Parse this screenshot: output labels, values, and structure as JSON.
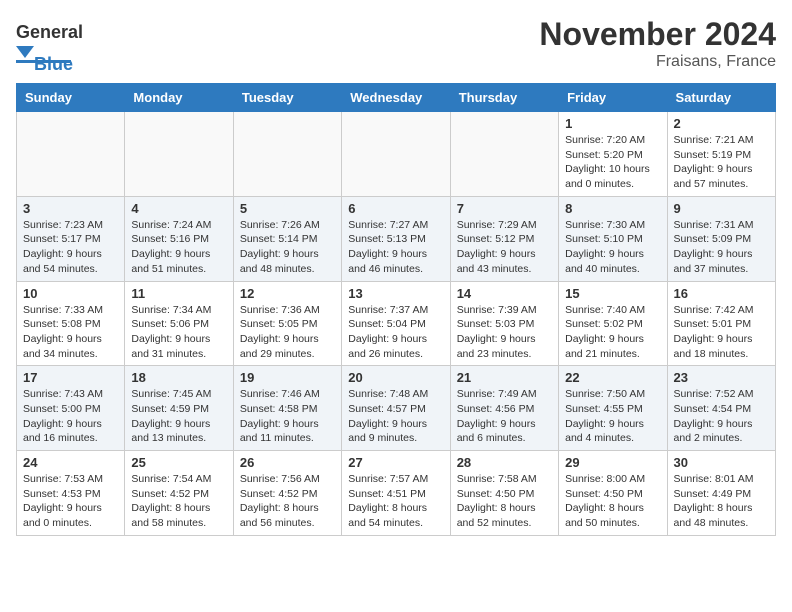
{
  "header": {
    "logo_general": "General",
    "logo_blue": "Blue",
    "title": "November 2024",
    "subtitle": "Fraisans, France"
  },
  "weekdays": [
    "Sunday",
    "Monday",
    "Tuesday",
    "Wednesday",
    "Thursday",
    "Friday",
    "Saturday"
  ],
  "weeks": [
    [
      {
        "day": "",
        "empty": true
      },
      {
        "day": "",
        "empty": true
      },
      {
        "day": "",
        "empty": true
      },
      {
        "day": "",
        "empty": true
      },
      {
        "day": "",
        "empty": true
      },
      {
        "day": "1",
        "sunrise": "7:20 AM",
        "sunset": "5:20 PM",
        "daylight": "10 hours and 0 minutes."
      },
      {
        "day": "2",
        "sunrise": "7:21 AM",
        "sunset": "5:19 PM",
        "daylight": "9 hours and 57 minutes."
      }
    ],
    [
      {
        "day": "3",
        "sunrise": "7:23 AM",
        "sunset": "5:17 PM",
        "daylight": "9 hours and 54 minutes."
      },
      {
        "day": "4",
        "sunrise": "7:24 AM",
        "sunset": "5:16 PM",
        "daylight": "9 hours and 51 minutes."
      },
      {
        "day": "5",
        "sunrise": "7:26 AM",
        "sunset": "5:14 PM",
        "daylight": "9 hours and 48 minutes."
      },
      {
        "day": "6",
        "sunrise": "7:27 AM",
        "sunset": "5:13 PM",
        "daylight": "9 hours and 46 minutes."
      },
      {
        "day": "7",
        "sunrise": "7:29 AM",
        "sunset": "5:12 PM",
        "daylight": "9 hours and 43 minutes."
      },
      {
        "day": "8",
        "sunrise": "7:30 AM",
        "sunset": "5:10 PM",
        "daylight": "9 hours and 40 minutes."
      },
      {
        "day": "9",
        "sunrise": "7:31 AM",
        "sunset": "5:09 PM",
        "daylight": "9 hours and 37 minutes."
      }
    ],
    [
      {
        "day": "10",
        "sunrise": "7:33 AM",
        "sunset": "5:08 PM",
        "daylight": "9 hours and 34 minutes."
      },
      {
        "day": "11",
        "sunrise": "7:34 AM",
        "sunset": "5:06 PM",
        "daylight": "9 hours and 31 minutes."
      },
      {
        "day": "12",
        "sunrise": "7:36 AM",
        "sunset": "5:05 PM",
        "daylight": "9 hours and 29 minutes."
      },
      {
        "day": "13",
        "sunrise": "7:37 AM",
        "sunset": "5:04 PM",
        "daylight": "9 hours and 26 minutes."
      },
      {
        "day": "14",
        "sunrise": "7:39 AM",
        "sunset": "5:03 PM",
        "daylight": "9 hours and 23 minutes."
      },
      {
        "day": "15",
        "sunrise": "7:40 AM",
        "sunset": "5:02 PM",
        "daylight": "9 hours and 21 minutes."
      },
      {
        "day": "16",
        "sunrise": "7:42 AM",
        "sunset": "5:01 PM",
        "daylight": "9 hours and 18 minutes."
      }
    ],
    [
      {
        "day": "17",
        "sunrise": "7:43 AM",
        "sunset": "5:00 PM",
        "daylight": "9 hours and 16 minutes."
      },
      {
        "day": "18",
        "sunrise": "7:45 AM",
        "sunset": "4:59 PM",
        "daylight": "9 hours and 13 minutes."
      },
      {
        "day": "19",
        "sunrise": "7:46 AM",
        "sunset": "4:58 PM",
        "daylight": "9 hours and 11 minutes."
      },
      {
        "day": "20",
        "sunrise": "7:48 AM",
        "sunset": "4:57 PM",
        "daylight": "9 hours and 9 minutes."
      },
      {
        "day": "21",
        "sunrise": "7:49 AM",
        "sunset": "4:56 PM",
        "daylight": "9 hours and 6 minutes."
      },
      {
        "day": "22",
        "sunrise": "7:50 AM",
        "sunset": "4:55 PM",
        "daylight": "9 hours and 4 minutes."
      },
      {
        "day": "23",
        "sunrise": "7:52 AM",
        "sunset": "4:54 PM",
        "daylight": "9 hours and 2 minutes."
      }
    ],
    [
      {
        "day": "24",
        "sunrise": "7:53 AM",
        "sunset": "4:53 PM",
        "daylight": "9 hours and 0 minutes."
      },
      {
        "day": "25",
        "sunrise": "7:54 AM",
        "sunset": "4:52 PM",
        "daylight": "8 hours and 58 minutes."
      },
      {
        "day": "26",
        "sunrise": "7:56 AM",
        "sunset": "4:52 PM",
        "daylight": "8 hours and 56 minutes."
      },
      {
        "day": "27",
        "sunrise": "7:57 AM",
        "sunset": "4:51 PM",
        "daylight": "8 hours and 54 minutes."
      },
      {
        "day": "28",
        "sunrise": "7:58 AM",
        "sunset": "4:50 PM",
        "daylight": "8 hours and 52 minutes."
      },
      {
        "day": "29",
        "sunrise": "8:00 AM",
        "sunset": "4:50 PM",
        "daylight": "8 hours and 50 minutes."
      },
      {
        "day": "30",
        "sunrise": "8:01 AM",
        "sunset": "4:49 PM",
        "daylight": "8 hours and 48 minutes."
      }
    ]
  ]
}
